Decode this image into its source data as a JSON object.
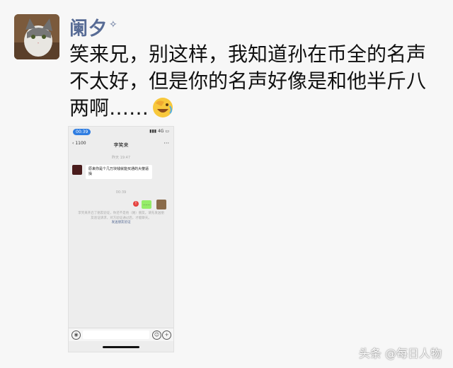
{
  "post": {
    "author": "阑夕",
    "lines": [
      "笑来兄，别这样，我知道孙在币全的名声",
      "不太好，但是你的名声好像是和他半斤八",
      "两啊……"
    ],
    "emoji": "facepalm-laughing-emoji"
  },
  "phone": {
    "status_time": "00:39",
    "status_icons": "4G",
    "back_label": "1100",
    "chat_title": "李笑来",
    "time_1": "昨天 19:47",
    "incoming_message": "原来你是个几万块钱就能买通的大傻逼 操",
    "time_2": "00:39",
    "outgoing_message": "……",
    "fail_mark": "!",
    "system_note": "李笑来开启了朋友验证，你还不是他（她）朋友。请先发送朋友验证请求，对方验证通过后，才能聊天。",
    "system_link": "发送朋友验证"
  },
  "watermark": "头条 @每日人物"
}
